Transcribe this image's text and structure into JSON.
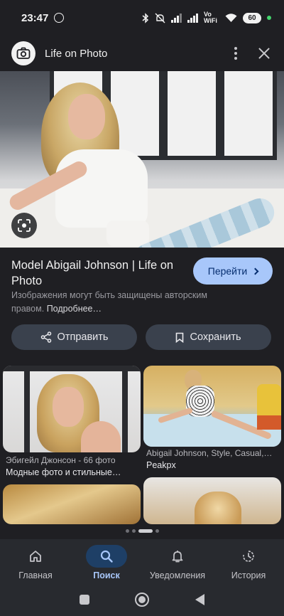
{
  "status_bar": {
    "time": "23:47",
    "network_label": "Vo WiFi",
    "battery": "60"
  },
  "header": {
    "title": "Life on Photo"
  },
  "result": {
    "title": "Model Abigail Johnson | Life on Photo",
    "visit_label": "Перейти",
    "disclaimer": "Изображения могут быть защищены авторским правом.",
    "disclaimer_more": "Подробнее…",
    "share_label": "Отправить",
    "save_label": "Сохранить"
  },
  "grid": [
    {
      "source": "Эбигейл Джонсон - 66 фото",
      "title": "Модные фото и стильные…"
    },
    {
      "source": "Abigail Johnson, Style, Casual,…",
      "title": "Peakpx"
    }
  ],
  "bottom_nav": {
    "items": [
      {
        "label": "Главная",
        "icon": "home-icon"
      },
      {
        "label": "Поиск",
        "icon": "search-icon",
        "active": true
      },
      {
        "label": "Уведомления",
        "icon": "bell-icon"
      },
      {
        "label": "История",
        "icon": "history-icon"
      }
    ]
  },
  "colors": {
    "background": "#1f1f23",
    "accent": "#a8c7fa",
    "button_bg": "#3a414d",
    "nav_active_bg": "#1e3f66"
  }
}
